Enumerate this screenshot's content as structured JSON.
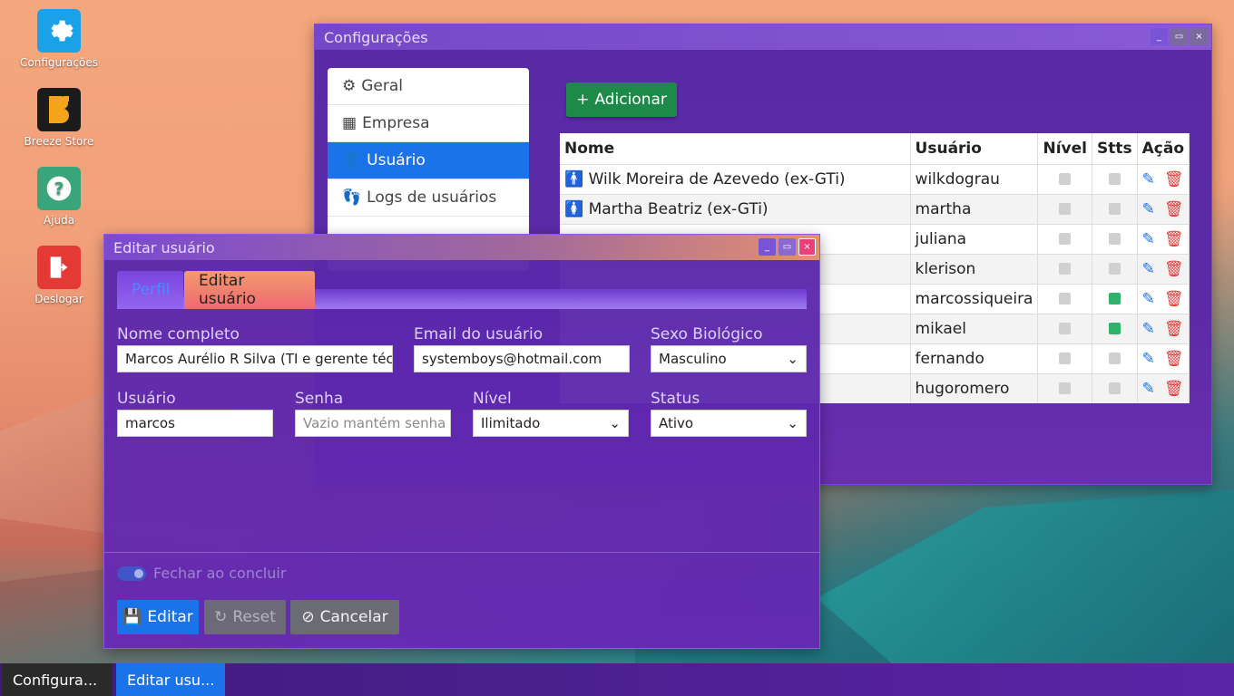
{
  "desktop": {
    "icons": [
      {
        "label": "Configurações",
        "icon": "gear-icon"
      },
      {
        "label": "Breeze Store",
        "icon": "store-icon"
      },
      {
        "label": "Ajuda",
        "icon": "help-icon"
      },
      {
        "label": "Deslogar",
        "icon": "logout-icon"
      }
    ]
  },
  "config_window": {
    "title": "Configurações",
    "sidebar": [
      {
        "label": "Geral",
        "icon": "gear-icon"
      },
      {
        "label": "Empresa",
        "icon": "building-icon"
      },
      {
        "label": "Usuário",
        "icon": "user-icon"
      },
      {
        "label": "Logs de usuários",
        "icon": "footprints-icon"
      }
    ],
    "add_button": "Adicionar",
    "table": {
      "headers": [
        "Nome",
        "Usuário",
        "Nível",
        "Stts",
        "Ação"
      ],
      "rows": [
        {
          "name": "Wilk Moreira de Azevedo (ex-GTi)",
          "user": "wilkdograu",
          "status": "off",
          "gender": "male"
        },
        {
          "name": "Martha Beatriz (ex-GTi)",
          "user": "martha",
          "status": "off",
          "gender": "female"
        },
        {
          "name": "",
          "user": "juliana",
          "status": "off",
          "gender": ""
        },
        {
          "name": "",
          "user": "klerison",
          "status": "off",
          "gender": ""
        },
        {
          "name": "",
          "user": "marcossiqueira",
          "status": "on",
          "gender": ""
        },
        {
          "name": "",
          "user": "mikael",
          "status": "on",
          "gender": ""
        },
        {
          "name": "",
          "user": "fernando",
          "status": "off",
          "gender": ""
        },
        {
          "name": "",
          "user": "hugoromero",
          "status": "off",
          "gender": ""
        }
      ]
    }
  },
  "edit_window": {
    "title": "Editar usuário",
    "tabs": [
      "Perfil",
      "Editar usuário"
    ],
    "fields": {
      "full_name": {
        "label": "Nome completo",
        "value": "Marcos Aurélio R Silva (TI e gerente técnic"
      },
      "email": {
        "label": "Email do usuário",
        "value": "systemboys@hotmail.com"
      },
      "sex": {
        "label": "Sexo Biológico",
        "value": "Masculino"
      },
      "username": {
        "label": "Usuário",
        "value": "marcos"
      },
      "password": {
        "label": "Senha",
        "placeholder": "Vazio mantém senha"
      },
      "level": {
        "label": "Nível",
        "value": "Ilimitado"
      },
      "status": {
        "label": "Status",
        "value": "Ativo"
      }
    },
    "close_toggle": "Fechar ao concluir",
    "buttons": {
      "edit": "Editar",
      "reset": "Reset",
      "cancel": "Cancelar"
    }
  },
  "taskbar": [
    "Configura...",
    "Editar usu..."
  ],
  "colors": {
    "accent": "#1a73e8",
    "success": "#1e8a4a",
    "danger": "#e53935",
    "window": "#5a2aa6"
  }
}
